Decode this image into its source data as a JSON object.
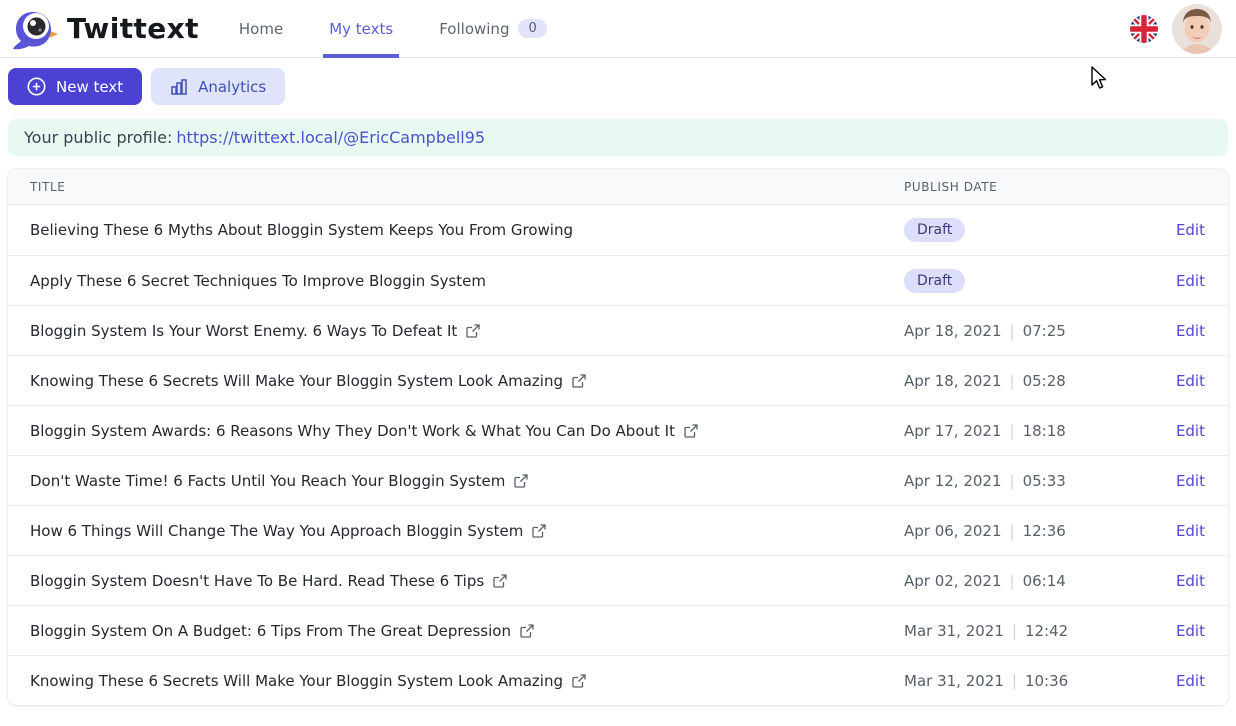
{
  "header": {
    "brand": "Twittext",
    "nav": [
      {
        "label": "Home",
        "active": false
      },
      {
        "label": "My texts",
        "active": true
      },
      {
        "label": "Following",
        "active": false,
        "badge": "0"
      }
    ],
    "language_flag": "uk-flag",
    "avatar": "user-profile-photo"
  },
  "toolbar": {
    "new_text_label": "New text",
    "analytics_label": "Analytics"
  },
  "profile_banner": {
    "text": "Your public profile:",
    "link": "https://twittext.local/@EricCampbell95"
  },
  "table": {
    "columns": [
      "TITLE",
      "PUBLISH DATE"
    ],
    "edit_label": "Edit",
    "draft_label": "Draft",
    "date_time_separator": "|",
    "rows": [
      {
        "title": "Believing These 6 Myths About Bloggin System Keeps You From Growing",
        "status": "draft",
        "external": false
      },
      {
        "title": "Apply These 6 Secret Techniques To Improve Bloggin System",
        "status": "draft",
        "external": false
      },
      {
        "title": "Bloggin System Is Your Worst Enemy. 6 Ways To Defeat It",
        "status": "published",
        "date": "Apr 18, 2021",
        "time": "07:25",
        "external": true
      },
      {
        "title": "Knowing These 6 Secrets Will Make Your Bloggin System Look Amazing",
        "status": "published",
        "date": "Apr 18, 2021",
        "time": "05:28",
        "external": true
      },
      {
        "title": "Bloggin System Awards: 6 Reasons Why They Don't Work & What You Can Do About It",
        "status": "published",
        "date": "Apr 17, 2021",
        "time": "18:18",
        "external": true
      },
      {
        "title": "Don't Waste Time! 6 Facts Until You Reach Your Bloggin System",
        "status": "published",
        "date": "Apr 12, 2021",
        "time": "05:33",
        "external": true
      },
      {
        "title": "How 6 Things Will Change The Way You Approach Bloggin System",
        "status": "published",
        "date": "Apr 06, 2021",
        "time": "12:36",
        "external": true
      },
      {
        "title": "Bloggin System Doesn't Have To Be Hard. Read These 6 Tips",
        "status": "published",
        "date": "Apr 02, 2021",
        "time": "06:14",
        "external": true
      },
      {
        "title": "Bloggin System On A Budget: 6 Tips From The Great Depression",
        "status": "published",
        "date": "Mar 31, 2021",
        "time": "12:42",
        "external": true
      },
      {
        "title": "Knowing These 6 Secrets Will Make Your Bloggin System Look Amazing",
        "status": "published",
        "date": "Mar 31, 2021",
        "time": "10:36",
        "external": true
      }
    ]
  },
  "colors": {
    "primary_button_bg": "#4b42d4",
    "secondary_button_bg": "#dfe3fb",
    "secondary_button_text": "#4150b5",
    "active_tab": "#5a5fd8",
    "banner_bg": "#e8f9f2",
    "link": "#4c51c9",
    "draft_badge_bg": "#dcdefb",
    "draft_badge_text": "#3b3b80"
  }
}
